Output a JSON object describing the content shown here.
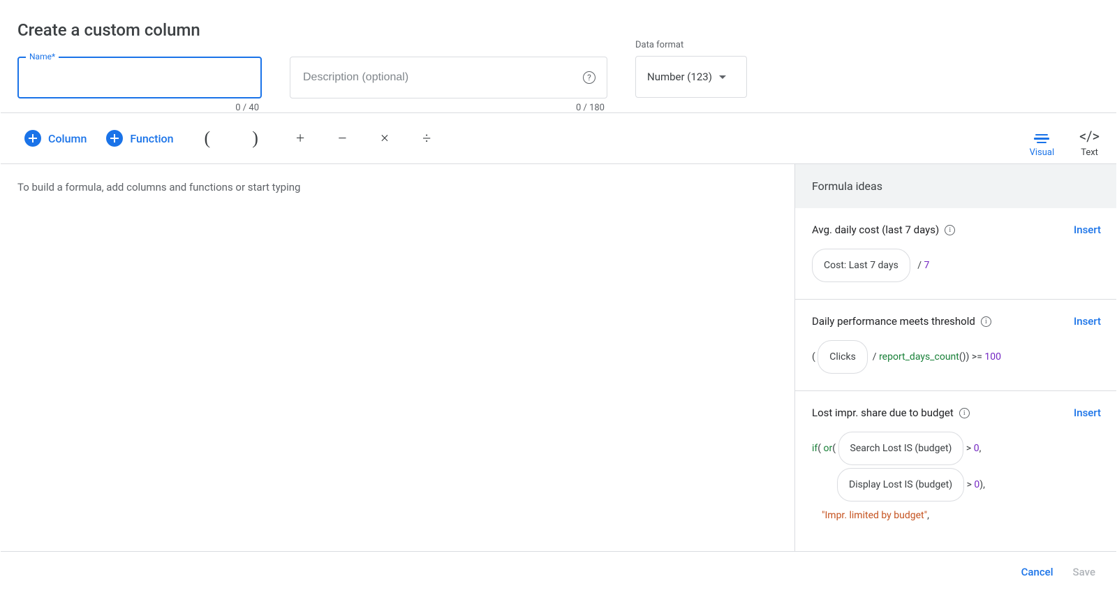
{
  "page_title": "Create a custom column",
  "name_field": {
    "label": "Name*",
    "value": "",
    "counter": "0 / 40"
  },
  "desc_field": {
    "placeholder": "Description (optional)",
    "value": "",
    "counter": "0 / 180"
  },
  "data_format": {
    "label": "Data format",
    "selected": "Number (123)"
  },
  "toolbar": {
    "column_label": "Column",
    "function_label": "Function",
    "paren_open": "(",
    "paren_close": ")",
    "plus": "+",
    "minus": "−",
    "multiply": "×",
    "divide": "÷",
    "visual_label": "Visual",
    "text_label": "Text"
  },
  "formula_placeholder": "To build a formula, add columns and functions or start typing",
  "ideas_panel": {
    "header": "Formula ideas",
    "insert_label": "Insert",
    "ideas": [
      {
        "title": "Avg. daily cost (last 7 days)",
        "formula": {
          "chip1": "Cost: Last 7 days",
          "text_after_chip": " / ",
          "num": "7"
        }
      },
      {
        "title": "Daily performance meets threshold",
        "formula": {
          "open": "( ",
          "chip1": "Clicks",
          "text_mid": " / ",
          "func": "report_days_count",
          "tail1": "()) >= ",
          "num": "100"
        }
      },
      {
        "title": "Lost impr. share due to budget",
        "formula": {
          "line1_pre_func": "if",
          "line1_open": "( ",
          "line1_func2": "or",
          "line1_open2": "( ",
          "chip1": "Search Lost IS (budget)",
          "line1_gt": " > ",
          "num1": "0",
          "line1_comma": ",",
          "chip2": "Display Lost IS (budget)",
          "line2_gt": " > ",
          "num2": "0",
          "line2_tail": "),",
          "string_val": "\"Impr. limited by budget\"",
          "line3_tail": ","
        }
      }
    ]
  },
  "footer": {
    "cancel": "Cancel",
    "save": "Save"
  }
}
